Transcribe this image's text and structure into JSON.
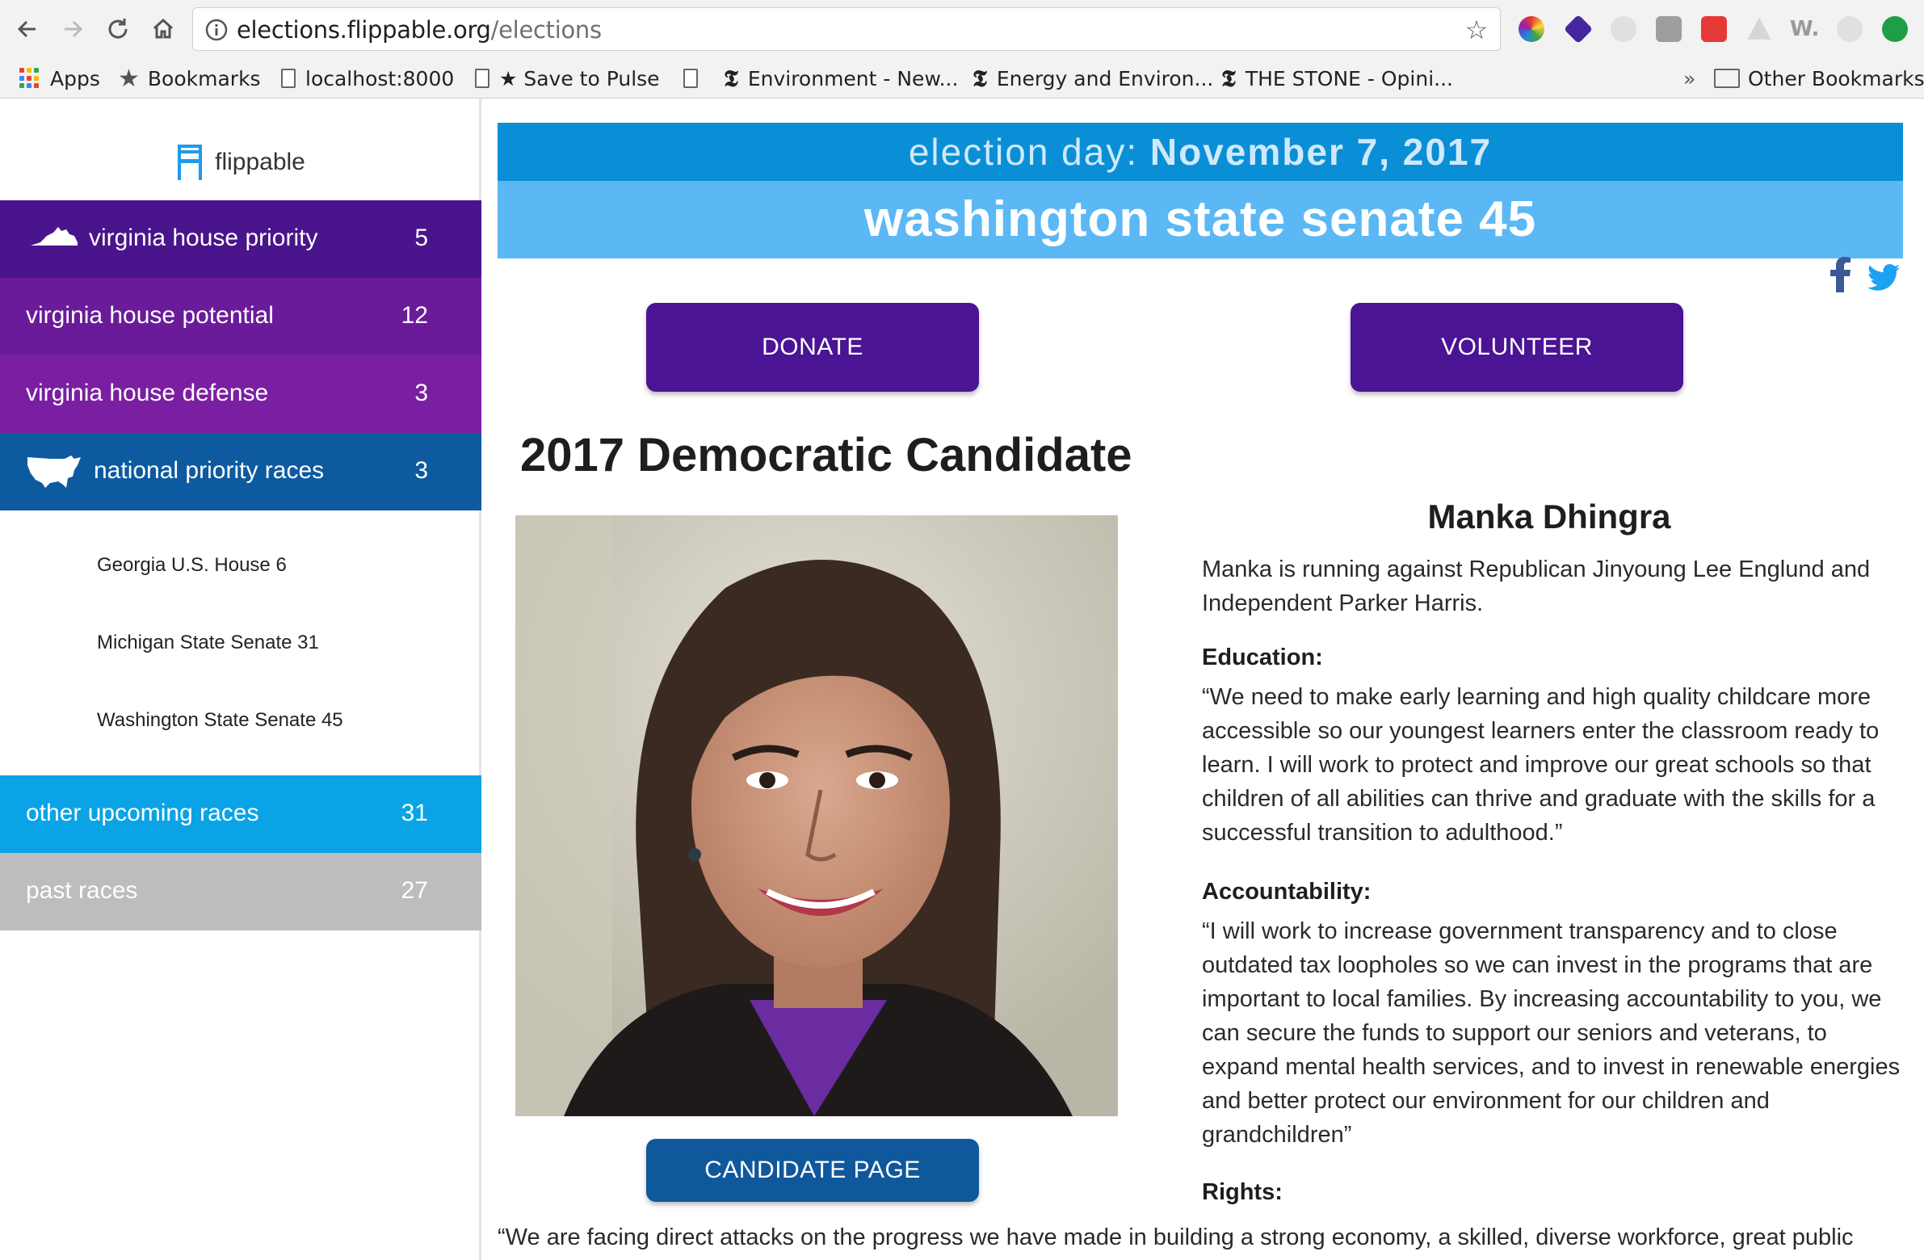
{
  "browser": {
    "url_host": "elections.flippable.org",
    "url_path": "/elections",
    "bookmarks": [
      {
        "label": "Apps",
        "icon": "apps-grid-icon"
      },
      {
        "label": "Bookmarks",
        "icon": "star-icon"
      },
      {
        "label": "localhost:8000",
        "icon": "page-icon"
      },
      {
        "label": "★ Save to Pulse",
        "icon": "page-icon"
      },
      {
        "label": "",
        "icon": "page-icon"
      },
      {
        "label": "Environment - New...",
        "icon": "nyt-icon"
      },
      {
        "label": "Energy and Environ...",
        "icon": "nyt-icon"
      },
      {
        "label": "THE STONE - Opini...",
        "icon": "nyt-icon"
      }
    ],
    "overflow": "»",
    "other_bookmarks": "Other Bookmarks"
  },
  "sidebar": {
    "brand": "flippable",
    "items": [
      {
        "label": "virginia house priority",
        "count": "5",
        "color": "#4a148c",
        "icon": "virginia-icon"
      },
      {
        "label": "virginia house potential",
        "count": "12",
        "color": "#6a1b9a",
        "icon": ""
      },
      {
        "label": "virginia house defense",
        "count": "3",
        "color": "#7b1fa2",
        "icon": ""
      },
      {
        "label": "national priority races",
        "count": "3",
        "color": "#0d5aa0",
        "icon": "usa-map-icon"
      }
    ],
    "sub_items": [
      "Georgia U.S. House 6",
      "Michigan State Senate 31",
      "Washington State Senate 45"
    ],
    "lower_items": [
      {
        "label": "other upcoming races",
        "count": "31",
        "color": "#0aa3e6"
      },
      {
        "label": "past races",
        "count": "27",
        "color": "#bdbdbd"
      }
    ]
  },
  "main": {
    "election_prefix": "election day: ",
    "election_date": "November 7, 2017",
    "race_title": "washington state senate 45",
    "donate": "DONATE",
    "volunteer": "VOLUNTEER",
    "heading": "2017 Democratic Candidate",
    "candidate_page": "CANDIDATE PAGE",
    "candidate_name": "Manka Dhingra",
    "intro": "Manka is running against Republican Jinyoung Lee Englund and Independent Parker Harris.",
    "education_label": "Education:",
    "education_text": "“We need to make early learning and high quality childcare more accessible so our youngest learners enter the classroom ready to learn. I will work to protect and improve our great schools so that children of all abilities can thrive and graduate with the skills for a successful transition to adulthood.”",
    "accountability_label": "Accountability:",
    "accountability_text": "“I will work to increase government transparency and to close outdated tax loopholes so we can invest in the programs that are important to local families. By increasing accountability to you, we can secure the funds to support our seniors and veterans, to expand mental health services, and to invest in renewable energies and better protect our environment for our children and grandchildren”",
    "rights_label": "Rights:",
    "rights_text": "“We are facing direct attacks on the progress we have made in building a strong economy, a skilled, diverse workforce, great public"
  }
}
